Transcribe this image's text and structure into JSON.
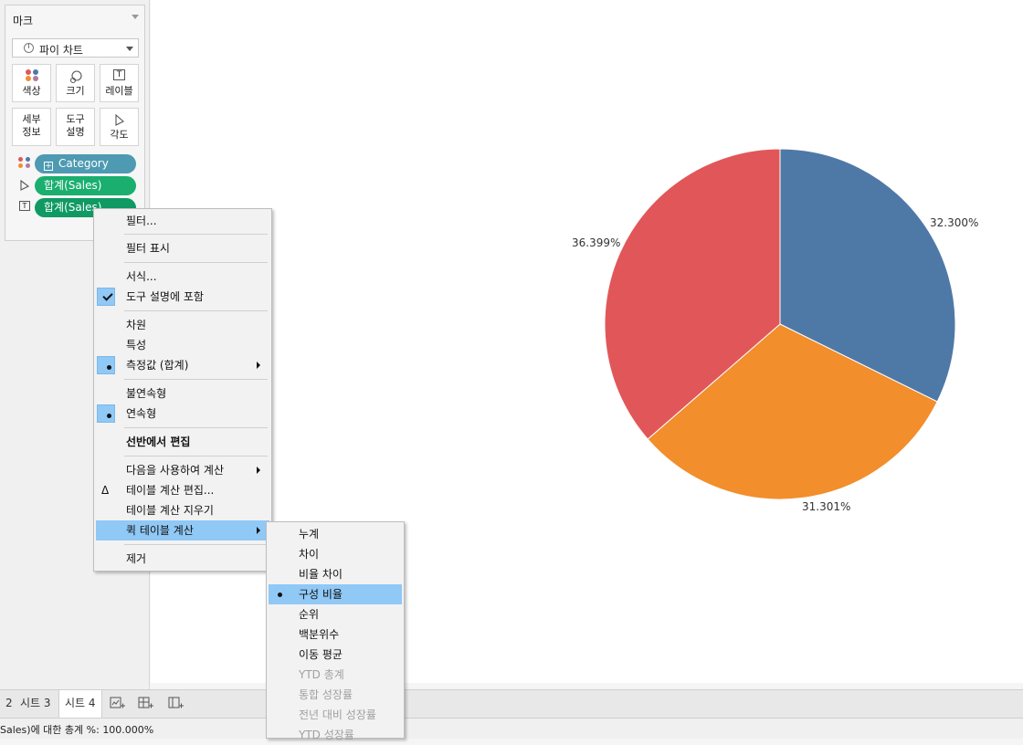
{
  "marks_card": {
    "title": "마크",
    "mark_type": "파이 차트",
    "buttons": {
      "color": "색상",
      "size": "크기",
      "label": "레이블",
      "detail": "세부\n정보",
      "detail_l1": "세부",
      "detail_l2": "정보",
      "tooltip_l1": "도구",
      "tooltip_l2": "설명",
      "angle": "각도"
    },
    "pills": [
      {
        "label": "Category",
        "type": "color"
      },
      {
        "label": "합계(Sales)",
        "type": "angle"
      },
      {
        "label": "합계(Sales)",
        "type": "label"
      }
    ]
  },
  "chart_data": {
    "type": "pie",
    "slices": [
      {
        "value": 32.3,
        "label": "32.300%",
        "color": "#4e79a7"
      },
      {
        "value": 31.301,
        "label": "31.301%",
        "color": "#f28e2b"
      },
      {
        "value": 36.399,
        "label": "36.399%",
        "color": "#e15759"
      }
    ]
  },
  "context_menu": {
    "items": [
      {
        "label": "필터..."
      },
      {
        "label": "필터 표시"
      },
      {
        "label": "서식..."
      },
      {
        "label": "도구 설명에 포함",
        "checked": true
      },
      {
        "label": "차원"
      },
      {
        "label": "특성"
      },
      {
        "label": "측정값 (합계)",
        "selected": true,
        "submenu": true
      },
      {
        "label": "불연속형"
      },
      {
        "label": "연속형",
        "selected": true
      },
      {
        "label": "선반에서 편집",
        "bold": true
      },
      {
        "label": "다음을 사용하여 계산",
        "submenu": true
      },
      {
        "label": "테이블 계산 편집...",
        "icon": "Δ"
      },
      {
        "label": "테이블 계산 지우기"
      },
      {
        "label": "퀵 테이블 계산",
        "submenu": true,
        "highlight": true
      },
      {
        "label": "제거"
      }
    ]
  },
  "quick_calc_menu": {
    "items": [
      {
        "label": "누계"
      },
      {
        "label": "차이"
      },
      {
        "label": "비율 차이"
      },
      {
        "label": "구성 비율",
        "selected": true,
        "highlight": true
      },
      {
        "label": "순위"
      },
      {
        "label": "백분위수"
      },
      {
        "label": "이동 평균"
      },
      {
        "label": "YTD 총계",
        "disabled": true
      },
      {
        "label": "통합 성장률",
        "disabled": true
      },
      {
        "label": "전년 대비 성장률",
        "disabled": true
      },
      {
        "label": "YTD 성장률",
        "disabled": true
      }
    ]
  },
  "sheet_tabs": [
    "2",
    "시트 3",
    "시트 4"
  ],
  "active_tab": "시트 4",
  "status_text": "Sales)에 대한 총계 %: 100.000%",
  "colors": {
    "pill_blue": "#4e9ab2",
    "pill_green": "#1aaf6f",
    "menu_highlight": "#90c8f6"
  }
}
